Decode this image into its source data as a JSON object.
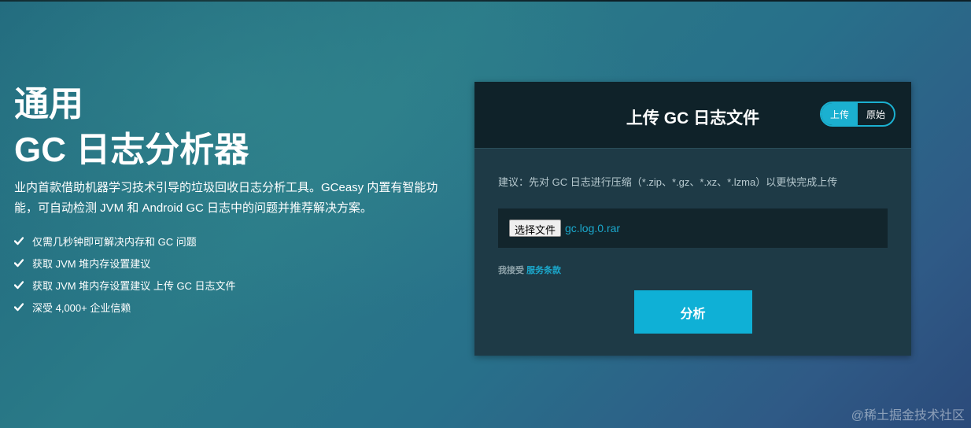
{
  "hero": {
    "title_line1": "通用",
    "title_line2": "GC 日志分析器",
    "description": "业内首款借助机器学习技术引导的垃圾回收日志分析工具。GCeasy 内置有智能功能，可自动检测 JVM 和 Android GC 日志中的问题并推荐解决方案。",
    "features": [
      "仅需几秒钟即可解决内存和 GC 问题",
      "获取 JVM 堆内存设置建议",
      "获取 JVM 堆内存设置建议 上传 GC 日志文件",
      "深受 4,000+ 企业信赖"
    ],
    "feature_icon": "check-icon"
  },
  "card": {
    "title": "上传 GC 日志文件",
    "toggle": {
      "upload": "上传",
      "raw": "原始",
      "active": "upload"
    },
    "hint": "建议：先对 GC 日志进行压缩（*.zip、*.gz、*.xz、*.lzma）以更快完成上传",
    "file_button": "选择文件",
    "file_name": "gc.log.0.rar",
    "terms_prefix": "我接受",
    "terms_link": "服务条款",
    "analyze_button": "分析"
  },
  "watermark": "@稀土掘金技术社区",
  "colors": {
    "accent": "#0fb0d6",
    "link": "#1ba8cc",
    "card_header": "#0f2229",
    "card_body": "#1e3a46"
  }
}
